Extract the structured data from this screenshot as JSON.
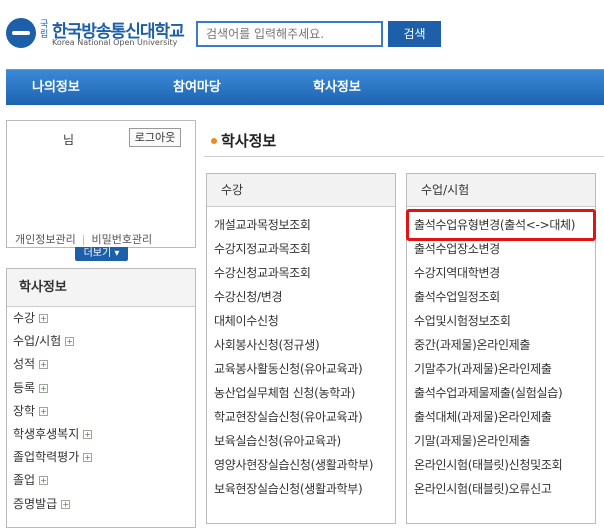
{
  "header": {
    "logo_small": "국립",
    "logo_name": "한국방송통신대학교",
    "logo_english": "Korea National Open University",
    "search_placeholder": "검색어를 입력해주세요.",
    "search_button": "검색"
  },
  "gnb": [
    "나의정보",
    "참여마당",
    "학사정보"
  ],
  "login": {
    "user_suffix": "님",
    "logout": "로그아웃",
    "link_personal": "개인정보관리",
    "link_password": "비밀번호관리",
    "more": "더보기 ▾"
  },
  "side": {
    "title": "학사정보",
    "items": [
      "수강",
      "수업/시험",
      "성적",
      "등록",
      "장학",
      "학생후생복지",
      "졸업학력평가",
      "졸업",
      "증명발급"
    ],
    "expand_glyph": "+"
  },
  "page_title": "학사정보",
  "panel_left": {
    "title": "수강",
    "items": [
      "개설교과목정보조회",
      "수강지정교과목조회",
      "수강신청교과목조회",
      "수강신청/변경",
      "대체이수신청",
      "사회봉사신청(정규생)",
      "교육봉사활동신청(유아교육과)",
      "농산업실무체험 신청(농학과)",
      "학교현장실습신청(유아교육과)",
      "보육실습신청(유아교육과)",
      "영양사현장실습신청(생활과학부)",
      "보육현장실습신청(생활과학부)"
    ]
  },
  "panel_right": {
    "title": "수업/시험",
    "items": [
      "출석수업유형변경(출석<->대체)",
      "출석수업장소변경",
      "수강지역대학변경",
      "출석수업일정조회",
      "수업및시험정보조회",
      "중간(과제물)온라인제출",
      "기말추가(과제물)온라인제출",
      "출석수업과제물제출(실험실습)",
      "출석대체(과제물)온라인제출",
      "기말(과제물)온라인제출",
      "온라인시험(태블릿)신청및조회",
      "온라인시험(태블릿)오류신고"
    ]
  },
  "colors": {
    "brand": "#1d5fa8",
    "highlight": "#e01414",
    "bullet": "#f08a1a"
  }
}
